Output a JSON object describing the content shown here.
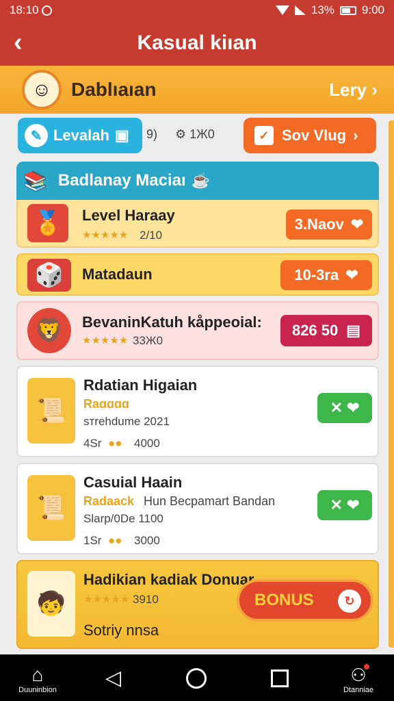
{
  "status_bar": {
    "time": "18:10",
    "battery": "13%",
    "clock": "9:00"
  },
  "app_bar": {
    "back_icon": "chevron-left-icon",
    "title": "Kasual kiıan"
  },
  "subheader": {
    "name": "Dablıaıan",
    "link": "Lery"
  },
  "filters": {
    "left_pill": "Levalah",
    "count_a": "9)",
    "count_b": "1Ж0",
    "right_pill": "Sov Vlug"
  },
  "section": {
    "title": "Badlanay Maciaı"
  },
  "cards": [
    {
      "title": "Level Haraay",
      "stars": "★★★★★",
      "meta": "2/10",
      "button": "3.Naov",
      "button_color": "#f26a23"
    },
    {
      "title": "Matadaun",
      "button": "10-3ra",
      "button_color": "#f26a23"
    },
    {
      "title": "BevaninKatuh kåppeoial:",
      "stars": "★★★★★",
      "meta": "33Ж0",
      "button": "826 50",
      "button_color": "#c9244e"
    },
    {
      "title": "Rdatian Higaian",
      "subtitle": "Raɑɑɑɑ",
      "line2": "sтrehdume 2021",
      "stat_a": "4Sr",
      "stat_b": "4000",
      "button_color": "#3db64a"
    },
    {
      "title": "Casuial Haain",
      "subtitle": "Radaack",
      "subtitle_rest": "Hun Becpamart Bandan",
      "line2": "Slarp/0De 1100",
      "stat_a": "1Sr",
      "stat_b": "3000",
      "button_color": "#3db64a"
    },
    {
      "title": "Hadikian kadiak Donuar",
      "stars": "★★★★★",
      "meta": "3910",
      "line2": "Sotriy nnsa"
    }
  ],
  "bonus": {
    "label": "BONUS"
  },
  "bottom_nav": {
    "left_label": "Duuninbion",
    "right_label": "Dtanniae"
  }
}
